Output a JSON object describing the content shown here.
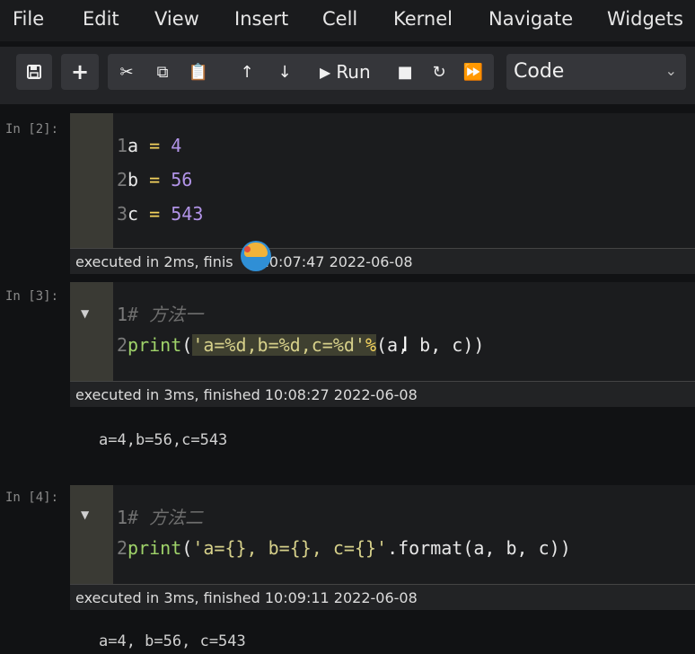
{
  "menu": [
    "File",
    "Edit",
    "View",
    "Insert",
    "Cell",
    "Kernel",
    "Navigate",
    "Widgets"
  ],
  "toolbar": {
    "save_icon": "floppy-disk-icon",
    "add_icon": "plus-icon",
    "run_label": "Run",
    "cell_type": "Code"
  },
  "cells": [
    {
      "prompt": "In [2]:",
      "lines": [
        {
          "n": "1",
          "var": "a",
          "op": "=",
          "val": "4"
        },
        {
          "n": "2",
          "var": "b",
          "op": "=",
          "val": "56"
        },
        {
          "n": "3",
          "var": "c",
          "op": "=",
          "val": "543"
        }
      ],
      "exec_before": "executed in 2ms, finis",
      "exec_after": "10:07:47 2022-06-08"
    },
    {
      "prompt": "In [3]:",
      "comment": "# 方法一",
      "code": {
        "n1": "1",
        "n2": "2",
        "fn": "print",
        "open": "(",
        "str": "'a=%d,b=%d,c=%d'",
        "op": "%",
        "rest": "(a, b, c))"
      },
      "exec": "executed in 3ms, finished 10:08:27 2022-06-08",
      "output": "a=4,b=56,c=543"
    },
    {
      "prompt": "In [4]:",
      "comment": "# 方法二",
      "code": {
        "n1": "1",
        "n2": "2",
        "fn": "print",
        "open": "(",
        "str": "'a={}, b={}, c={}'",
        "rest": ".format(a, b, c))"
      },
      "exec": "executed in 3ms, finished 10:09:11 2022-06-08",
      "output": "a=4, b=56, c=543"
    }
  ]
}
